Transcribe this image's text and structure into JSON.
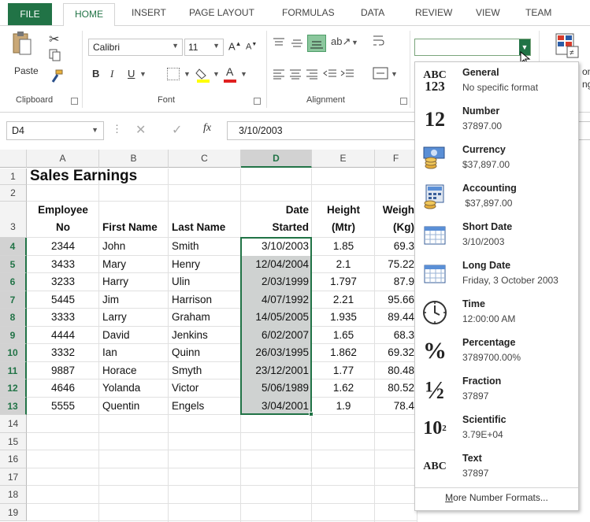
{
  "tabs": [
    "FILE",
    "HOME",
    "INSERT",
    "PAGE LAYOUT",
    "FORMULAS",
    "DATA",
    "REVIEW",
    "VIEW",
    "TEAM"
  ],
  "ribbon": {
    "paste_label": "Paste",
    "font_name": "Calibri",
    "font_size": "11",
    "bold": "B",
    "italic": "I",
    "underline": "U",
    "groups": {
      "clipboard": "Clipboard",
      "font": "Font",
      "alignment": "Alignment"
    },
    "number_format_value": "",
    "conditional_partial": "ona\nng"
  },
  "formula_bar": {
    "name_box": "D4",
    "fx": "fx",
    "formula": "3/10/2003"
  },
  "columns": [
    "A",
    "B",
    "C",
    "D",
    "E",
    "F"
  ],
  "rows": [
    "1",
    "2",
    "3",
    "4",
    "5",
    "6",
    "7",
    "8",
    "9",
    "10",
    "11",
    "12",
    "13",
    "14",
    "15",
    "16",
    "17",
    "18",
    "19"
  ],
  "sheet": {
    "title": "Sales Earnings",
    "headers": {
      "employee_1": "Employee",
      "employee_2": "No",
      "first_name": "First Name",
      "last_name": "Last Name",
      "date_1": "Date",
      "date_2": "Started",
      "height_1": "Height",
      "height_2": "(Mtr)",
      "weight_1": "Weigh",
      "weight_2": "(Kg)"
    },
    "records": [
      [
        "2344",
        "John",
        "Smith",
        "3/10/2003",
        "1.85",
        "69.3"
      ],
      [
        "3433",
        "Mary",
        "Henry",
        "12/04/2004",
        "2.1",
        "75.22"
      ],
      [
        "3233",
        "Harry",
        "Ulin",
        "2/03/1999",
        "1.797",
        "87.9"
      ],
      [
        "5445",
        "Jim",
        "Harrison",
        "4/07/1992",
        "2.21",
        "95.66"
      ],
      [
        "3333",
        "Larry",
        "Graham",
        "14/05/2005",
        "1.935",
        "89.44"
      ],
      [
        "4444",
        "David",
        "Jenkins",
        "6/02/2007",
        "1.65",
        "68.3"
      ],
      [
        "3332",
        "Ian",
        "Quinn",
        "26/03/1995",
        "1.862",
        "69.32"
      ],
      [
        "9887",
        "Horace",
        "Smyth",
        "23/12/2001",
        "1.77",
        "80.48"
      ],
      [
        "4646",
        "Yolanda",
        "Victor",
        "5/06/1989",
        "1.62",
        "80.52"
      ],
      [
        "5555",
        "Quentin",
        "Engels",
        "3/04/2001",
        "1.9",
        "78.4"
      ]
    ]
  },
  "number_formats": [
    {
      "icon": "abc-123-icon",
      "title": "General",
      "sub": "No specific format",
      "glyph_top": "ABC",
      "glyph_bottom": "123"
    },
    {
      "icon": "number-12-icon",
      "title": "Number",
      "sub": "37897.00",
      "glyph": "12"
    },
    {
      "icon": "currency-icon",
      "title": "Currency",
      "sub": "$37,897.00"
    },
    {
      "icon": "accounting-icon",
      "title": "Accounting",
      "sub": " $37,897.00"
    },
    {
      "icon": "short-date-icon",
      "title": "Short Date",
      "sub": "3/10/2003"
    },
    {
      "icon": "long-date-icon",
      "title": "Long Date",
      "sub": "Friday, 3 October 2003"
    },
    {
      "icon": "clock-icon",
      "title": "Time",
      "sub": "12:00:00 AM"
    },
    {
      "icon": "percent-icon",
      "title": "Percentage",
      "sub": "3789700.00%",
      "glyph": "%"
    },
    {
      "icon": "fraction-icon",
      "title": "Fraction",
      "sub": "37897",
      "glyph": "½"
    },
    {
      "icon": "scientific-icon",
      "title": "Scientific",
      "sub": "3.79E+04",
      "glyph": "10",
      "glyph_sup": "2"
    },
    {
      "icon": "abc-text-icon",
      "title": "Text",
      "sub": "37897",
      "glyph": "ABC"
    }
  ],
  "more_formats": "More Number Formats...",
  "colors": {
    "excel_green": "#217346",
    "selection_fill": "#cfd2d1",
    "header_bg": "#f3f3f3"
  }
}
